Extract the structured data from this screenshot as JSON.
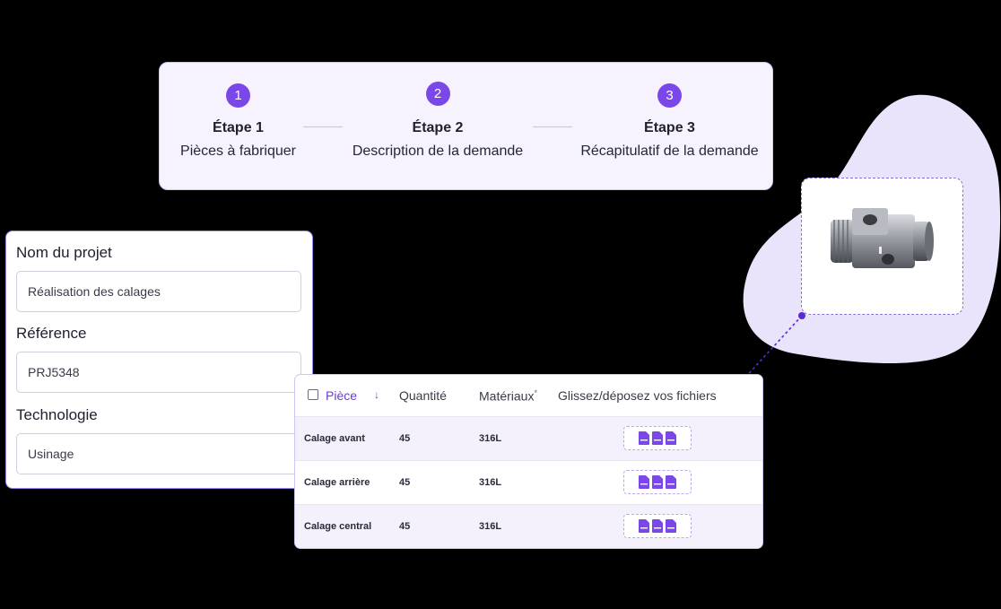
{
  "steps": [
    {
      "number": "1",
      "title": "Étape 1",
      "subtitle": "Pièces à fabriquer"
    },
    {
      "number": "2",
      "title": "Étape 2",
      "subtitle": "Description de la demande"
    },
    {
      "number": "3",
      "title": "Étape 3",
      "subtitle": "Récapitulatif de la demande"
    }
  ],
  "form": {
    "project_name_label": "Nom du projet",
    "project_name_value": "Réalisation des calages",
    "reference_label": "Référence",
    "reference_value": "PRJ5348",
    "technology_label": "Technologie",
    "technology_value": "Usinage"
  },
  "table": {
    "headers": {
      "piece": "Pièce",
      "sort_icon": "↓",
      "quantity": "Quantité",
      "material": "Matériaux",
      "material_mark": "*",
      "files": "Glissez/déposez vos fichiers"
    },
    "rows": [
      {
        "piece": "Calage avant",
        "quantity": "45",
        "material": "316L"
      },
      {
        "piece": "Calage arrière",
        "quantity": "45",
        "material": "316L"
      },
      {
        "piece": "Calage central",
        "quantity": "45",
        "material": "316L"
      }
    ]
  },
  "icons": {
    "file": "pdf-file-icon",
    "sort": "arrow-down-icon",
    "checkbox": "checkbox-icon"
  },
  "colors": {
    "accent": "#7b47e8",
    "blob": "#e9e3fb",
    "card_bg": "#f6f3fe",
    "row_highlight": "#f4f1fd"
  }
}
